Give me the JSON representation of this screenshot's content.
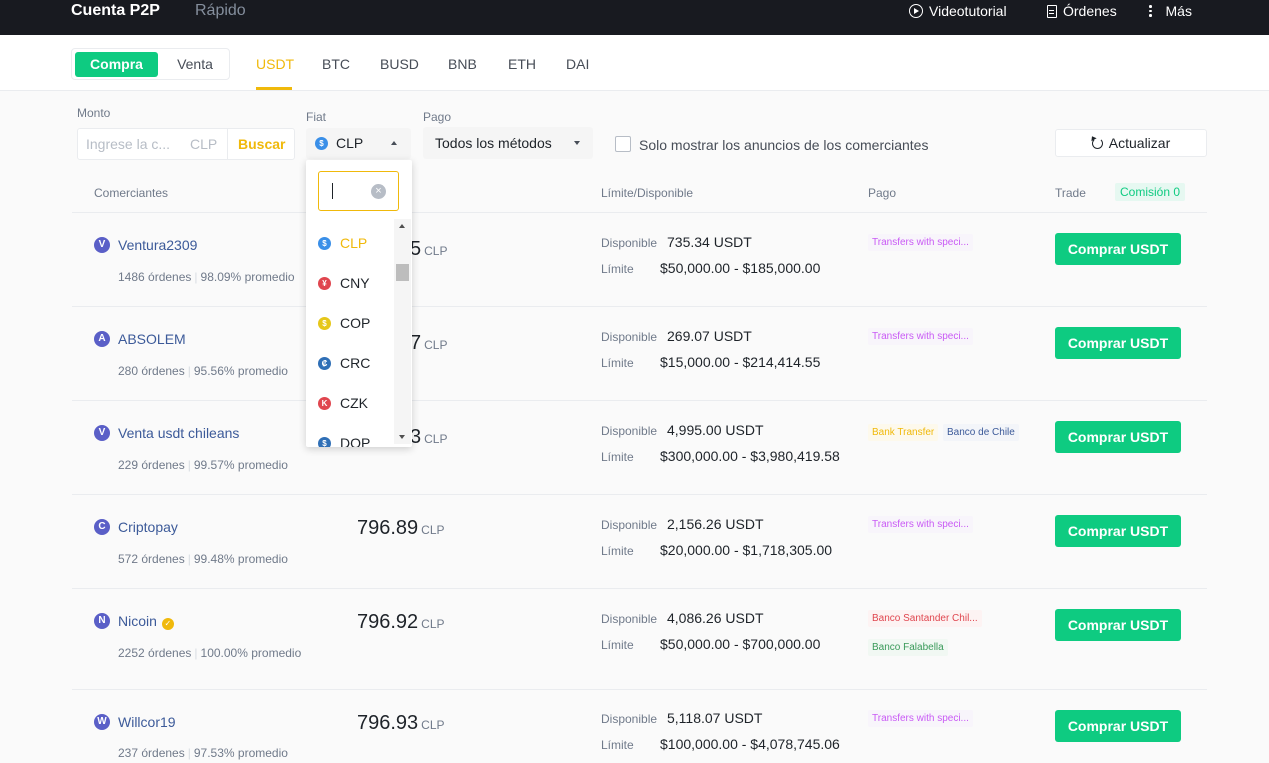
{
  "topnav": {
    "tabs": [
      "Cuenta P2P",
      "Rápido"
    ],
    "actions": {
      "videotutorial": "Videotutorial",
      "ordenes": "Órdenes",
      "mas": "Más"
    }
  },
  "trade_toggle": {
    "buy": "Compra",
    "sell": "Venta",
    "selected": "Compra"
  },
  "coins": {
    "items": [
      "USDT",
      "BTC",
      "BUSD",
      "BNB",
      "ETH",
      "DAI"
    ],
    "selected": "USDT"
  },
  "filters": {
    "monto": {
      "label": "Monto",
      "placeholder": "Ingrese la c...",
      "currency": "CLP",
      "search_button": "Buscar"
    },
    "fiat": {
      "label": "Fiat",
      "value": "CLP",
      "icon": "dollar-icon"
    },
    "pago": {
      "label": "Pago",
      "value": "Todos los métodos"
    },
    "merchants_only": {
      "label": "Solo mostrar los anuncios de los comerciantes",
      "checked": false
    },
    "refresh": "Actualizar"
  },
  "fiat_dropdown": {
    "search_value": "",
    "options": [
      {
        "code": "CLP",
        "symbol": "$",
        "color": "#3a8fe8"
      },
      {
        "code": "CNY",
        "symbol": "¥",
        "color": "#e0464f"
      },
      {
        "code": "COP",
        "symbol": "$",
        "color": "#e6c71a"
      },
      {
        "code": "CRC",
        "symbol": "₡",
        "color": "#2f6fb6"
      },
      {
        "code": "CZK",
        "symbol": "K",
        "color": "#e0464f"
      },
      {
        "code": "DOP",
        "symbol": "$",
        "color": "#2f6fb6"
      }
    ],
    "selected": "CLP"
  },
  "table": {
    "headers": {
      "merchants": "Comerciantes",
      "limit": "Límite/Disponible",
      "payment": "Pago",
      "trade": "Trade",
      "commission": "Comisión 0"
    },
    "labels": {
      "available": "Disponible",
      "limit": "Límite"
    },
    "buy_label": "Comprar USDT",
    "rows": [
      {
        "initial": "V",
        "name": "Ventura2309",
        "verified": false,
        "orders": "1486 órdenes",
        "completion": "98.09% promedio",
        "price": "5",
        "currency": "CLP",
        "available": "735.34 USDT",
        "limit": "$50,000.00 - $185,000.00",
        "payments": [
          {
            "text": "Transfers with speci...",
            "style": "purple"
          }
        ]
      },
      {
        "initial": "A",
        "name": "ABSOLEM",
        "verified": false,
        "orders": "280 órdenes",
        "completion": "95.56% promedio",
        "price": "7",
        "currency": "CLP",
        "available": "269.07 USDT",
        "limit": "$15,000.00 - $214,414.55",
        "payments": [
          {
            "text": "Transfers with speci...",
            "style": "purple"
          }
        ]
      },
      {
        "initial": "V",
        "name": "Venta usdt chileans",
        "verified": false,
        "orders": "229 órdenes",
        "completion": "99.57% promedio",
        "price": "3",
        "currency": "CLP",
        "available": "4,995.00 USDT",
        "limit": "$300,000.00 - $3,980,419.58",
        "payments": [
          {
            "text": "Bank Transfer",
            "style": "yellow"
          },
          {
            "text": "Banco de Chile",
            "style": "blue"
          }
        ]
      },
      {
        "initial": "C",
        "name": "Criptopay",
        "verified": false,
        "orders": "572 órdenes",
        "completion": "99.48% promedio",
        "price": "796.89",
        "currency": "CLP",
        "available": "2,156.26 USDT",
        "limit": "$20,000.00 - $1,718,305.00",
        "payments": [
          {
            "text": "Transfers with speci...",
            "style": "purple"
          }
        ]
      },
      {
        "initial": "N",
        "name": "Nicoin",
        "verified": true,
        "orders": "2252 órdenes",
        "completion": "100.00% promedio",
        "price": "796.92",
        "currency": "CLP",
        "available": "4,086.26 USDT",
        "limit": "$50,000.00 - $700,000.00",
        "payments": [
          {
            "text": "Banco Santander Chil...",
            "style": "red"
          },
          {
            "text": "Banco Falabella",
            "style": "green"
          }
        ]
      },
      {
        "initial": "W",
        "name": "Willcor19",
        "verified": false,
        "orders": "237 órdenes",
        "completion": "97.53% promedio",
        "price": "796.93",
        "currency": "CLP",
        "available": "5,118.07 USDT",
        "limit": "$100,000.00 - $4,078,745.06",
        "payments": [
          {
            "text": "Transfers with speci...",
            "style": "purple"
          }
        ]
      }
    ]
  },
  "colors": {
    "brand_yellow": "#f0b90b",
    "buy_green": "#0ecb81",
    "topbar_bg": "#181a20",
    "link_blue": "#3c5a99"
  }
}
